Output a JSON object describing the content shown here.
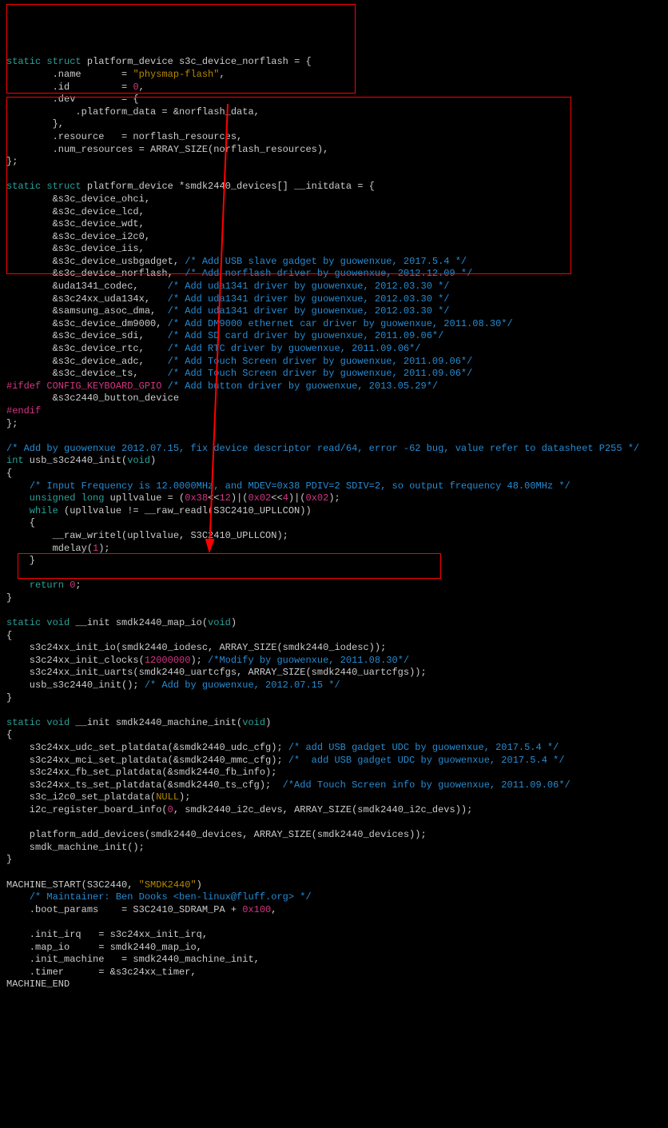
{
  "code": {
    "block1": {
      "l1a": "static struct",
      "l1b": " platform_device s3c_device_norflash = {",
      "l2a": "        .name       = ",
      "l2b": "\"physmap-flash\"",
      "l2c": ",",
      "l3a": "        .id         = ",
      "l3b": "0",
      "l3c": ",",
      "l4": "        .dev        = {",
      "l5": "            .platform_data = &norflash_data,",
      "l6": "        },",
      "l7": "        .resource   = norflash_resources,",
      "l8": "        .num_resources = ARRAY_SIZE(norflash_resources),",
      "l9": "};"
    },
    "block2": {
      "l1a": "static struct",
      "l1b": " platform_device *smdk2440_devices[] __initdata = {",
      "l2": "        &s3c_device_ohci,",
      "l3": "        &s3c_device_lcd,",
      "l4": "        &s3c_device_wdt,",
      "l5": "        &s3c_device_i2c0,",
      "l6": "        &s3c_device_iis,",
      "l7a": "        &s3c_device_usbgadget, ",
      "l7b": "/* Add USB slave gadget by guowenxue, 2017.5.4 */",
      "l8a": "        &s3c_device_norflash,  ",
      "l8b": "/* Add norflash driver by guowenxue, 2012.12.09 */",
      "l9a": "        &uda1341_codec,     ",
      "l9b": "/* Add uda1341 driver by guowenxue, 2012.03.30 */",
      "l10a": "        &s3c24xx_uda134x,   ",
      "l10b": "/* Add uda1341 driver by guowenxue, 2012.03.30 */",
      "l11a": "        &samsung_asoc_dma,  ",
      "l11b": "/* Add uda1341 driver by guowenxue, 2012.03.30 */",
      "l12a": "        &s3c_device_dm9000, ",
      "l12b": "/* Add DM9000 ethernet car driver by guowenxue, 2011.08.30*/",
      "l13a": "        &s3c_device_sdi,    ",
      "l13b": "/* Add SD card driver by guowenxue, 2011.09.06*/",
      "l14a": "        &s3c_device_rtc,    ",
      "l14b": "/* Add RTC driver by guowenxue, 2011.09.06*/",
      "l15a": "        &s3c_device_adc,    ",
      "l15b": "/* Add Touch Screen driver by guowenxue, 2011.09.06*/",
      "l16a": "        &s3c_device_ts,     ",
      "l16b": "/* Add Touch Screen driver by guowenxue, 2011.09.06*/",
      "l17a": "#ifdef CONFIG_KEYBOARD_GPIO",
      "l17b": " /* Add button driver by guowenxue, 2013.05.29*/",
      "l18": "        &s3c2440_button_device",
      "l19": "#endif",
      "l20": "};"
    },
    "block3": {
      "l1a": "/* Add by guowenxue 2012.07.15, fix device descriptor read/64, error -62 bug, value refer to datasheet P255 */",
      "l2a": "int",
      "l2b": " usb_s3c2440_init(",
      "l2c": "void",
      "l2d": ")",
      "l3": "{",
      "l4a": "    ",
      "l4b": "/* Input Frequency is 12.0000MHz, and MDEV=0x38 PDIV=2 SDIV=2, so output frequency 48.00MHz */",
      "l5a": "    unsigned long",
      "l5b": " upllvalue = (",
      "l5c": "0x38",
      "l5d": "<<",
      "l5e": "12",
      "l5f": ")|(",
      "l5g": "0x02",
      "l5h": "<<",
      "l5i": "4",
      "l5j": ")|(",
      "l5k": "0x02",
      "l5l": ");",
      "l6a": "    while",
      "l6b": " (upllvalue != __raw_readl(S3C2410_UPLLCON))",
      "l7": "    {",
      "l8": "        __raw_writel(upllvalue, S3C2410_UPLLCON);",
      "l9a": "        mdelay(",
      "l9b": "1",
      "l9c": ");",
      "l10": "    }",
      "l11": "",
      "l12a": "    return ",
      "l12b": "0",
      "l12c": ";",
      "l13": "}"
    },
    "block4": {
      "l1a": "static void",
      "l1b": " __init smdk2440_map_io(",
      "l1c": "void",
      "l1d": ")",
      "l2": "{",
      "l3": "    s3c24xx_init_io(smdk2440_iodesc, ARRAY_SIZE(smdk2440_iodesc));",
      "l4a": "    s3c24xx_init_clocks(",
      "l4b": "12000000",
      "l4c": "); ",
      "l4d": "/*Modify by guowenxue, 2011.08.30*/",
      "l5": "    s3c24xx_init_uarts(smdk2440_uartcfgs, ARRAY_SIZE(smdk2440_uartcfgs));",
      "l6a": "    usb_s3c2440_init(); ",
      "l6b": "/* Add by guowenxue, 2012.07.15 */",
      "l7": "}"
    },
    "block5": {
      "l1a": "static void",
      "l1b": " __init smdk2440_machine_init(",
      "l1c": "void",
      "l1d": ")",
      "l2": "{",
      "l3a": "    s3c24xx_udc_set_platdata(&smdk2440_udc_cfg); ",
      "l3b": "/* add USB gadget UDC by guowenxue, 2017.5.4 */",
      "l4a": "    s3c24xx_mci_set_platdata(&smdk2440_mmc_cfg); ",
      "l4b": "/*  add USB gadget UDC by guowenxue, 2017.5.4 */",
      "l5": "    s3c24xx_fb_set_platdata(&smdk2440_fb_info);",
      "l6a": "    s3c24xx_ts_set_platdata(&smdk2440_ts_cfg);  ",
      "l6b": "/*Add Touch Screen info by guowenxue, 2011.09.06*/",
      "l7a": "    s3c_i2c0_set_platdata(",
      "l7b": "NULL",
      "l7c": ");",
      "l8a": "    i2c_register_board_info(",
      "l8b": "0",
      "l8c": ", smdk2440_i2c_devs, ARRAY_SIZE(smdk2440_i2c_devs));",
      "l9": "",
      "l10": "    platform_add_devices(smdk2440_devices, ARRAY_SIZE(smdk2440_devices));",
      "l11": "    smdk_machine_init();",
      "l12": "}"
    },
    "block6": {
      "l1a": "MACHINE_START(S3C2440, ",
      "l1b": "\"SMDK2440\"",
      "l1c": ")",
      "l2a": "    ",
      "l2b": "/* Maintainer: Ben Dooks <ben-linux@fluff.org> */",
      "l3a": "    .boot_params    = S3C2410_SDRAM_PA + ",
      "l3b": "0x100",
      "l3c": ",",
      "l4": "",
      "l5": "    .init_irq   = s3c24xx_init_irq,",
      "l6": "    .map_io     = smdk2440_map_io,",
      "l7": "    .init_machine   = smdk2440_machine_init,",
      "l8": "    .timer      = &s3c24xx_timer,",
      "l9": "MACHINE_END"
    }
  }
}
